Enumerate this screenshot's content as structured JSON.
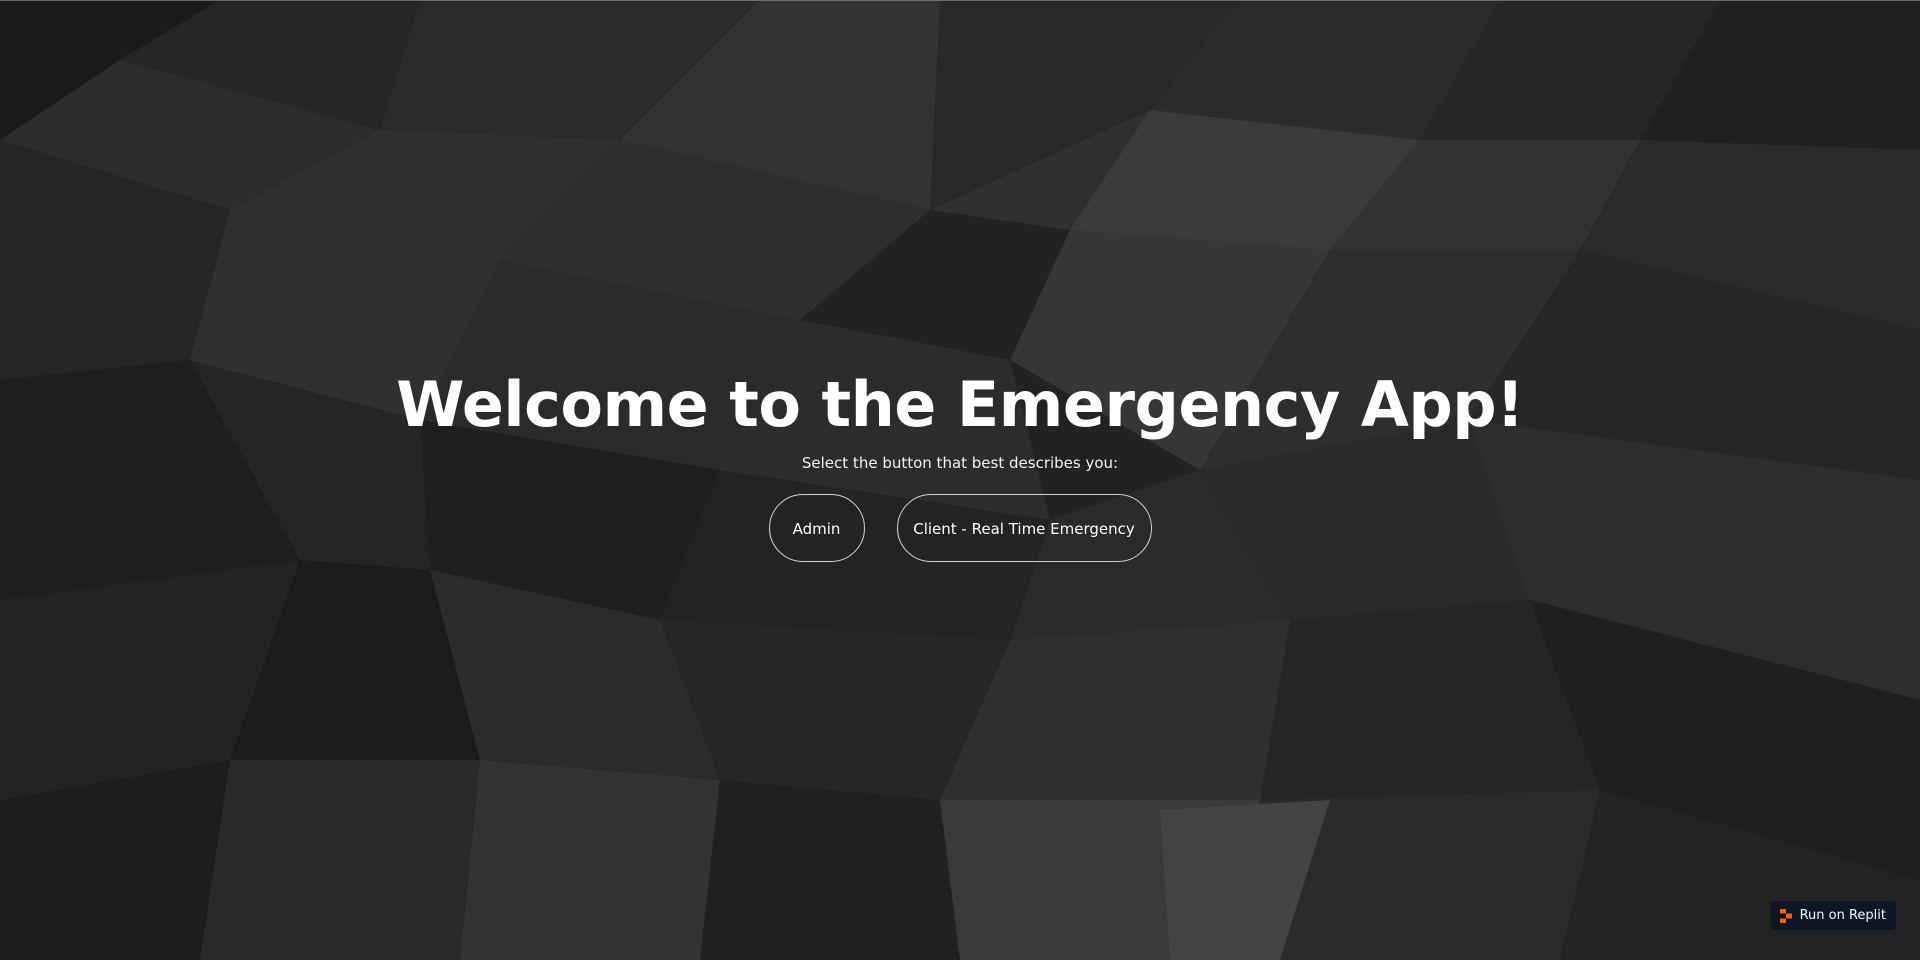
{
  "hero": {
    "title": "Welcome to the Emergency App!",
    "subtitle": "Select the button that best describes you:"
  },
  "buttons": {
    "admin_label": "Admin",
    "client_label": "Client - Real Time Emergency"
  },
  "badge": {
    "label": "Run on Replit",
    "icon": "replit-logo-icon",
    "icon_color": "#f26207",
    "background": "#0e1525"
  },
  "colors": {
    "background": "#1e1e20",
    "text": "#ffffff",
    "button_border": "#d6d6d6"
  }
}
